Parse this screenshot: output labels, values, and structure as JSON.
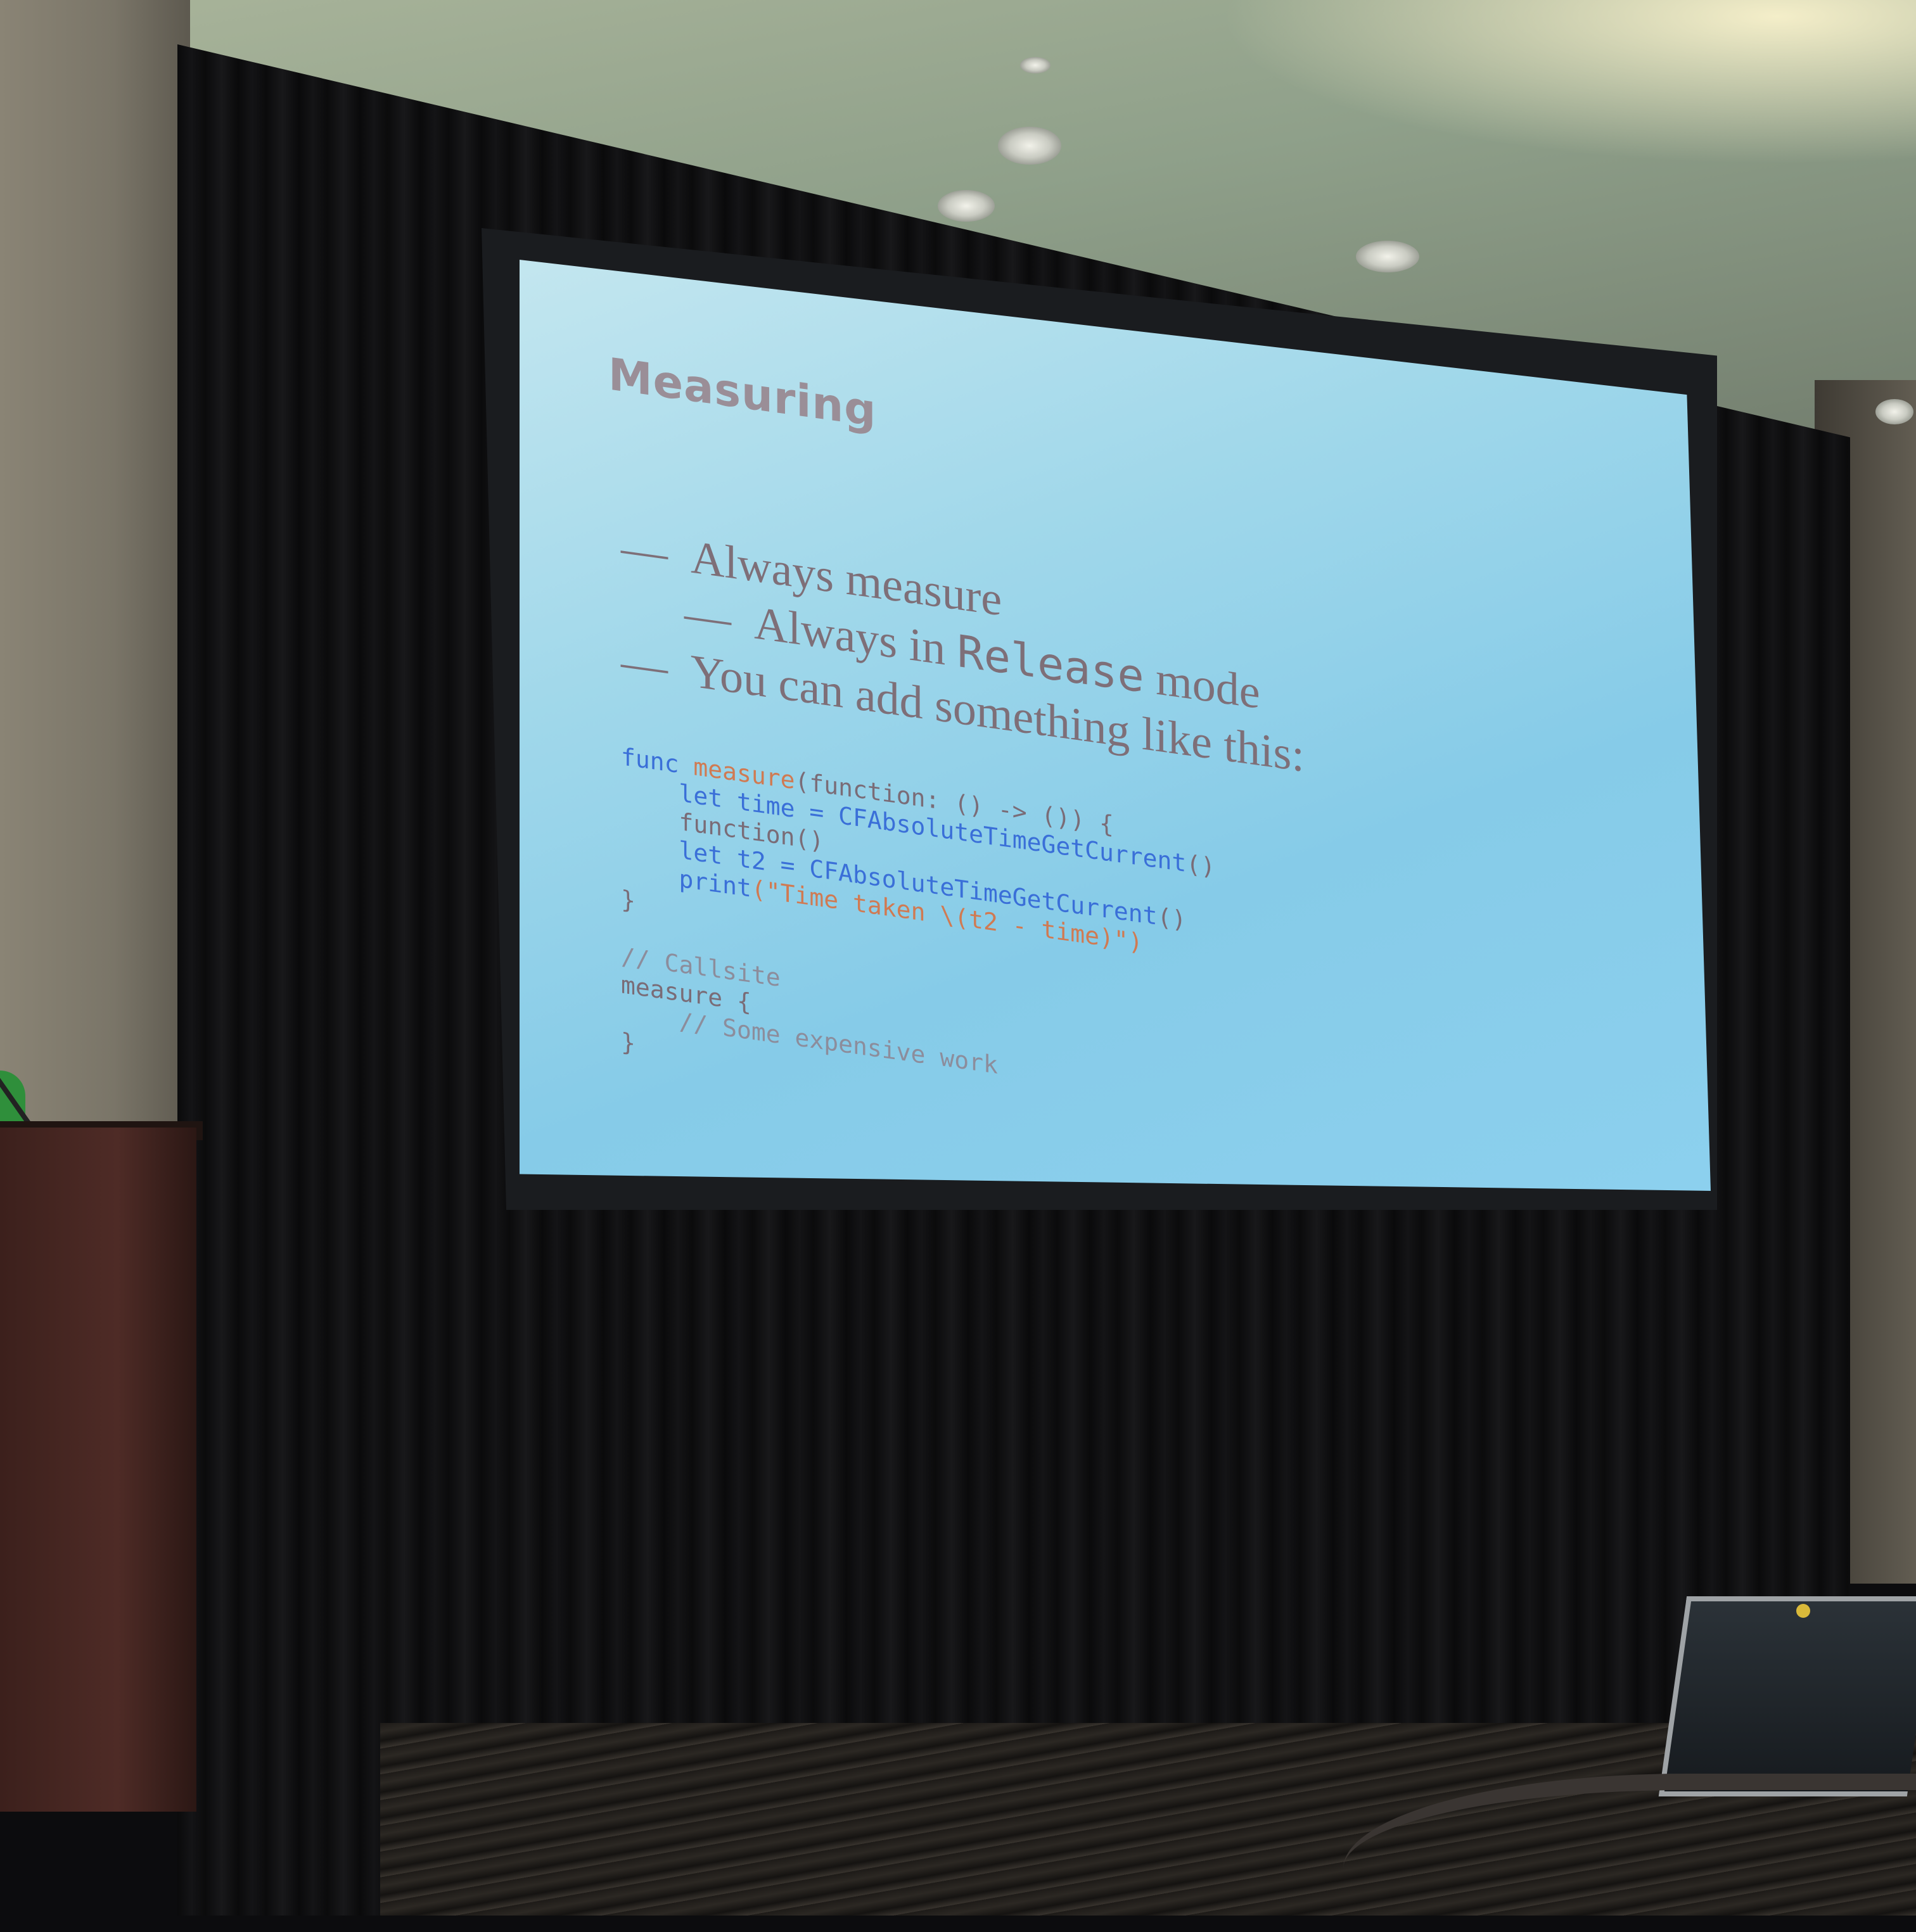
{
  "slide": {
    "title": "Measuring",
    "bullets": [
      {
        "level": 1,
        "dash": "—",
        "text": "Always measure"
      },
      {
        "level": 2,
        "dash": "—",
        "text_before": "Always in ",
        "code": "Release",
        "text_after": " mode"
      },
      {
        "level": 1,
        "dash": "—",
        "text": "You can add something like this:"
      }
    ],
    "code_lines": {
      "l1_kw": "func",
      "l1_name": " measure",
      "l1_rest": "(function: () -> ()) {",
      "l2_let": "    let time = ",
      "l2_call": "CFAbsoluteTimeGetCurrent",
      "l2_end": "()",
      "l3": "    function()",
      "l4_let": "    let t2 = ",
      "l4_call": "CFAbsoluteTimeGetCurrent",
      "l4_end": "()",
      "l5_print": "    print",
      "l5_str": "(\"Time taken \\(t2 - time)\")",
      "l6": "}",
      "l8": "// Callsite",
      "l9": "measure {",
      "l10": "    // Some expensive work",
      "l11": "}"
    }
  },
  "colors": {
    "screen": "#9fd7ea",
    "text": "#7e6f78",
    "keyword_blue": "#3a6fd8",
    "string_orange": "#d07a52",
    "podium": "#4e2b26"
  }
}
